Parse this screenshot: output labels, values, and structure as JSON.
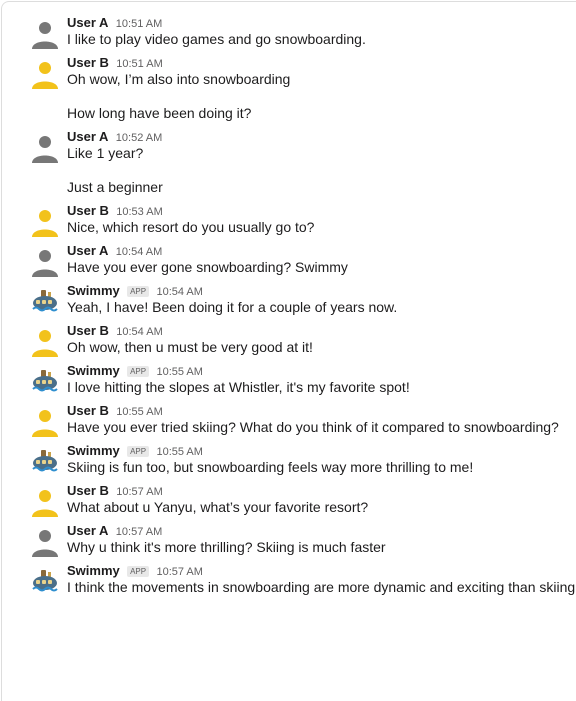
{
  "messages": [
    {
      "user": "User A",
      "avatar": "user-a",
      "app": "",
      "time": "10:51 AM",
      "lines": [
        "I like to play video games and go snowboarding."
      ]
    },
    {
      "user": "User B",
      "avatar": "user-b",
      "app": "",
      "time": "10:51 AM",
      "lines": [
        "Oh wow, I’m also into snowboarding",
        "How long have been doing it?"
      ]
    },
    {
      "user": "User A",
      "avatar": "user-a",
      "app": "",
      "time": "10:52 AM",
      "lines": [
        "Like 1 year?",
        "Just a beginner"
      ]
    },
    {
      "user": "User B",
      "avatar": "user-b",
      "app": "",
      "time": "10:53 AM",
      "lines": [
        "Nice, which resort do you usually go to?"
      ]
    },
    {
      "user": "User A",
      "avatar": "user-a",
      "app": "",
      "time": "10:54 AM",
      "lines": [
        "Have you ever gone snowboarding? Swimmy"
      ]
    },
    {
      "user": "Swimmy",
      "avatar": "swimmy",
      "app": "APP",
      "time": "10:54 AM",
      "lines": [
        "Yeah, I have! Been doing it for a couple of years now."
      ]
    },
    {
      "user": "User B",
      "avatar": "user-b",
      "app": "",
      "time": "10:54 AM",
      "lines": [
        "Oh wow, then u must be very good at it!"
      ]
    },
    {
      "user": "Swimmy",
      "avatar": "swimmy",
      "app": "APP",
      "time": "10:55 AM",
      "lines": [
        "I love hitting the slopes at Whistler, it's my favorite spot!"
      ]
    },
    {
      "user": "User B",
      "avatar": "user-b",
      "app": "",
      "time": "10:55 AM",
      "lines": [
        "Have you ever tried skiing? What do you think of it compared to snowboarding?"
      ]
    },
    {
      "user": "Swimmy",
      "avatar": "swimmy",
      "app": "APP",
      "time": "10:55 AM",
      "lines": [
        "Skiing is fun too, but snowboarding feels way more thrilling to me!"
      ]
    },
    {
      "user": "User B",
      "avatar": "user-b",
      "app": "",
      "time": "10:57 AM",
      "lines": [
        "What about u Yanyu, what’s your favorite resort?"
      ]
    },
    {
      "user": "User A",
      "avatar": "user-a",
      "app": "",
      "time": "10:57 AM",
      "lines": [
        "Why u think it's more thrilling? Skiing is much faster"
      ]
    },
    {
      "user": "Swimmy",
      "avatar": "swimmy",
      "app": "APP",
      "time": "10:57 AM",
      "lines": [
        "I think the movements in snowboarding are more dynamic and exciting than skiing."
      ]
    }
  ],
  "colors": {
    "user_a_avatar": "#777777",
    "user_b_avatar": "#f2c21b",
    "swimmy_body": "#4a6f8a"
  }
}
